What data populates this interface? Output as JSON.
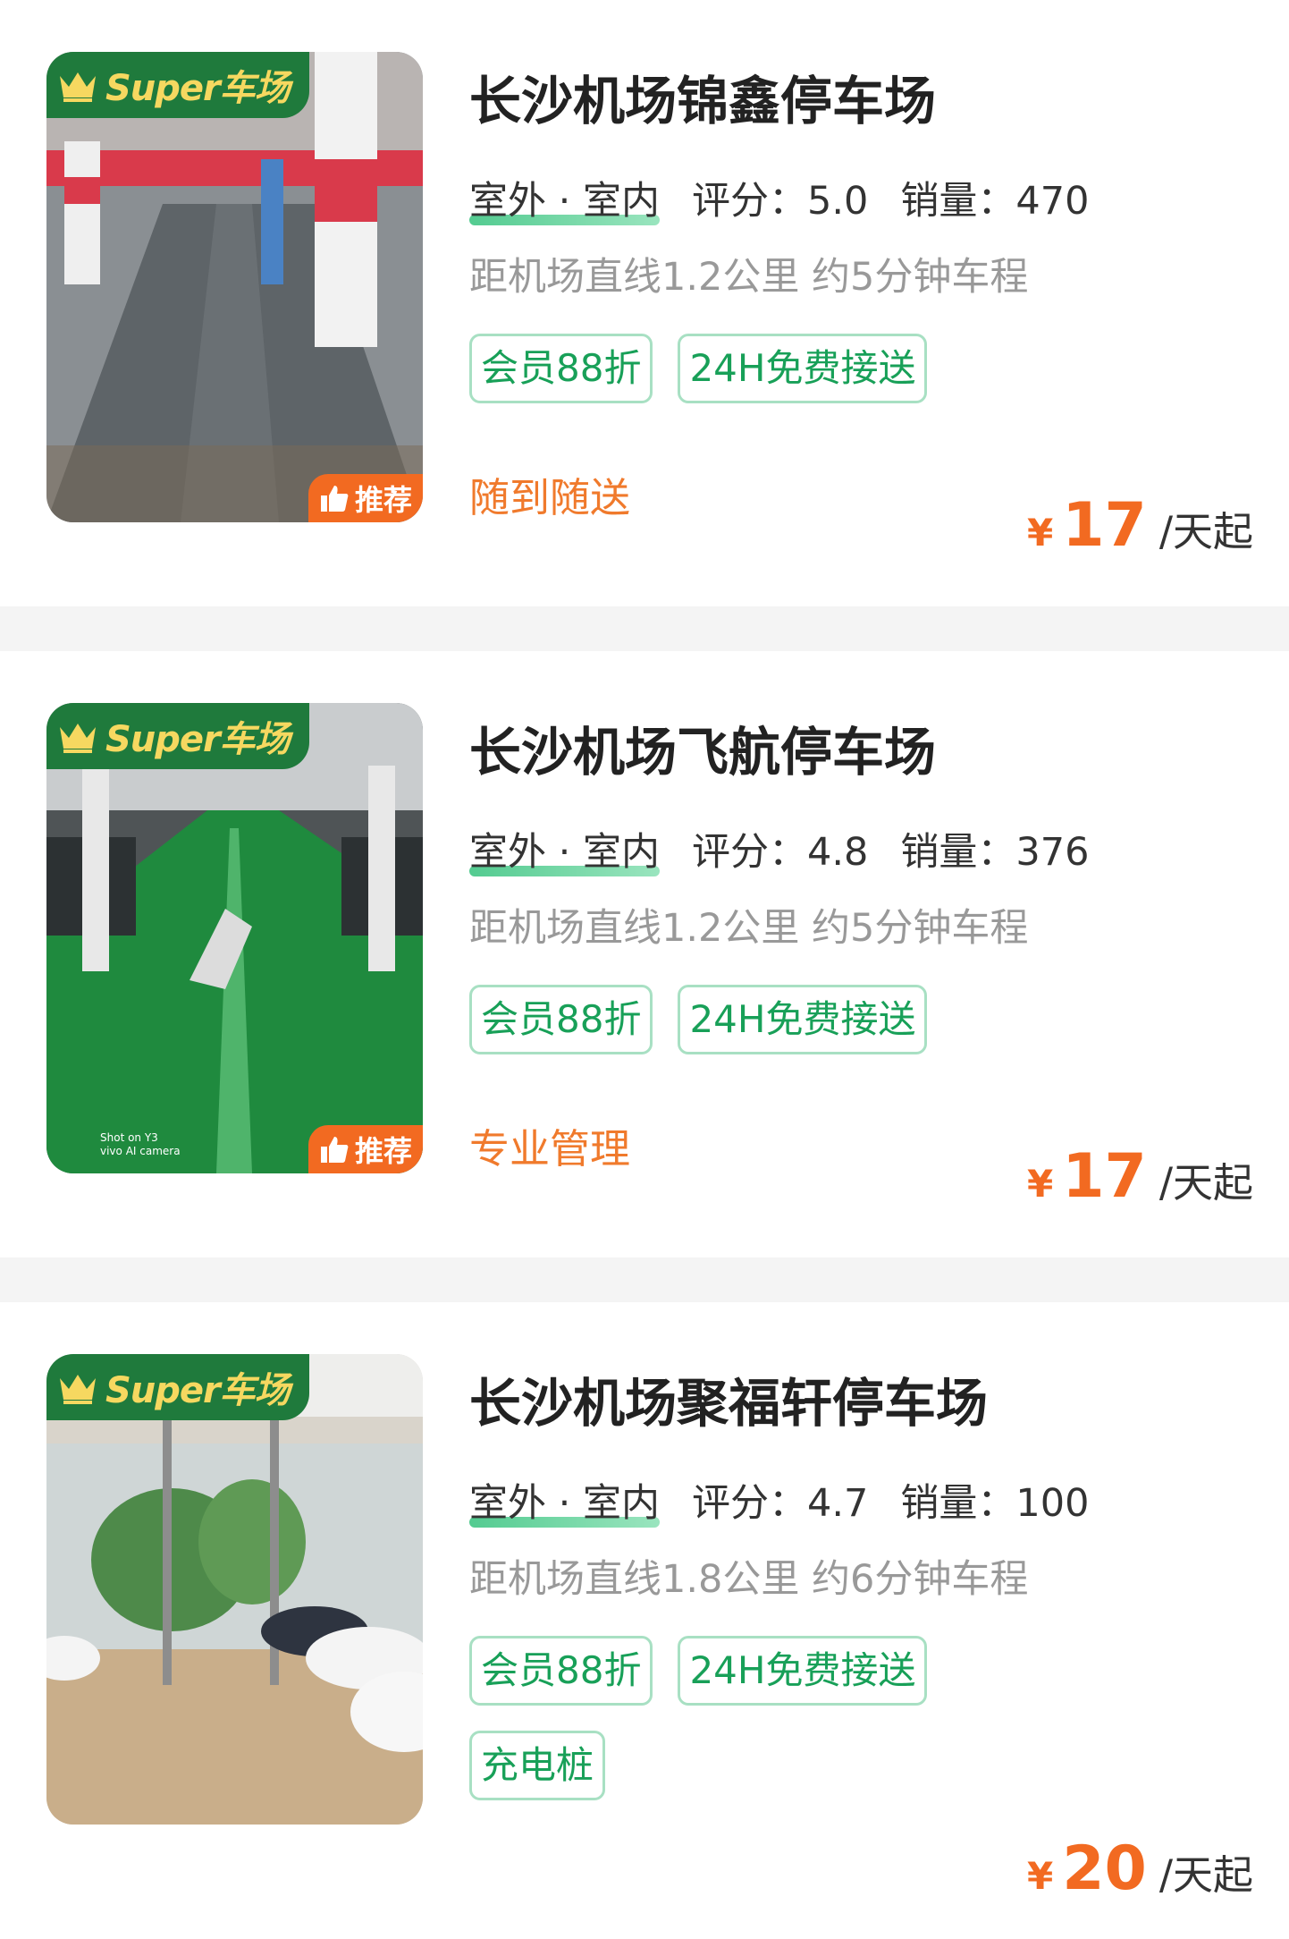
{
  "badges": {
    "super": "Super车场",
    "recommend": "推荐"
  },
  "colors": {
    "brand_green": "#1f7a3c",
    "accent_orange": "#f26a21",
    "tag_green": "#18a058"
  },
  "lots": [
    {
      "name": "长沙机场锦鑫停车场",
      "type": "室外 · 室内",
      "rating_label": "评分：",
      "rating": "5.0",
      "sales_label": "销量：",
      "sales": "470",
      "distance": "距机场直线1.2公里 约5分钟车程",
      "tags": [
        "会员88折",
        "24H免费接送"
      ],
      "feature": "随到随送",
      "recommended": true,
      "currency": "¥",
      "price": "17",
      "unit": "/天起",
      "photo": "underground-parking-red-pillars"
    },
    {
      "name": "长沙机场飞航停车场",
      "type": "室外 · 室内",
      "rating_label": "评分：",
      "rating": "4.8",
      "sales_label": "销量：",
      "sales": "376",
      "distance": "距机场直线1.2公里 约5分钟车程",
      "tags": [
        "会员88折",
        "24H免费接送"
      ],
      "feature": "专业管理",
      "recommended": true,
      "currency": "¥",
      "price": "17",
      "unit": "/天起",
      "photo_caption": [
        "Shot on Y3",
        "vivo AI camera"
      ],
      "photo": "underground-parking-green-floor"
    },
    {
      "name": "长沙机场聚福轩停车场",
      "type": "室外 · 室内",
      "rating_label": "评分：",
      "rating": "4.7",
      "sales_label": "销量：",
      "sales": "100",
      "distance": "距机场直线1.8公里 约6分钟车程",
      "tags": [
        "会员88折",
        "24H免费接送",
        "充电桩"
      ],
      "feature": "",
      "recommended": false,
      "currency": "¥",
      "price": "20",
      "unit": "/天起",
      "photo": "covered-outdoor-parking"
    }
  ]
}
